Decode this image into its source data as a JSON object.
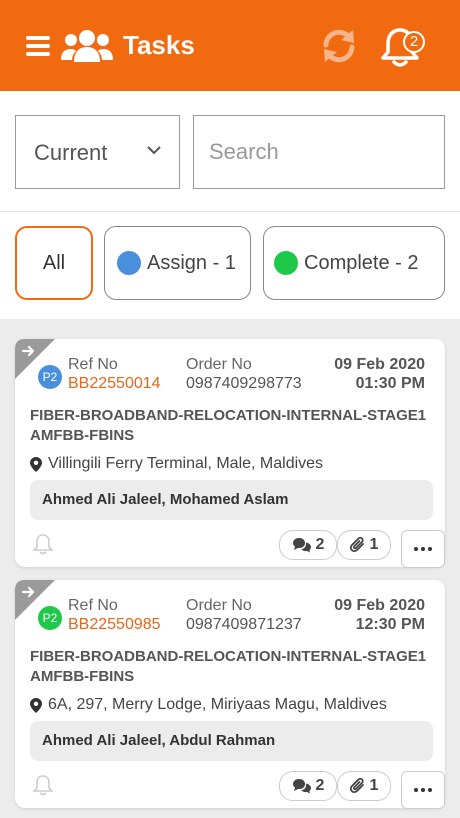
{
  "header": {
    "title": "Tasks",
    "notification_count": "2"
  },
  "filters": {
    "status_value": "Current",
    "search_placeholder": "Search"
  },
  "chips": {
    "all": "All",
    "assign": "Assign - 1",
    "complete": "Complete - 2"
  },
  "labels": {
    "ref_no": "Ref No",
    "order_no": "Order No"
  },
  "tasks": [
    {
      "priority": "P2",
      "priority_color": "#4a8fdc",
      "ref_no": "BB22550014",
      "order_no": "0987409298773",
      "date": "09 Feb 2020",
      "time": "01:30 PM",
      "title": "FIBER-BROADBAND-RELOCATION-INTERNAL-STAGE1 AMFBB-FBINS",
      "location": "Villingili Ferry Terminal, Male, Maldives",
      "assignees": "Ahmed Ali Jaleel, Mohamed Aslam",
      "comments": "2",
      "attachments": "1"
    },
    {
      "priority": "P2",
      "priority_color": "#1ec94a",
      "ref_no": "BB22550985",
      "order_no": "0987409871237",
      "date": "09 Feb 2020",
      "time": "12:30 PM",
      "title": "FIBER-BROADBAND-RELOCATION-INTERNAL-STAGE1 AMFBB-FBINS",
      "location": "6A, 297, Merry Lodge, Miriyaas Magu, Maldives",
      "assignees": "Ahmed Ali Jaleel, Abdul Rahman",
      "comments": "2",
      "attachments": "1"
    }
  ],
  "colors": {
    "brand": "#f26a0f",
    "ref_accent": "#e86614",
    "assign_dot": "#4a8fdc",
    "complete_dot": "#1ec94a"
  }
}
